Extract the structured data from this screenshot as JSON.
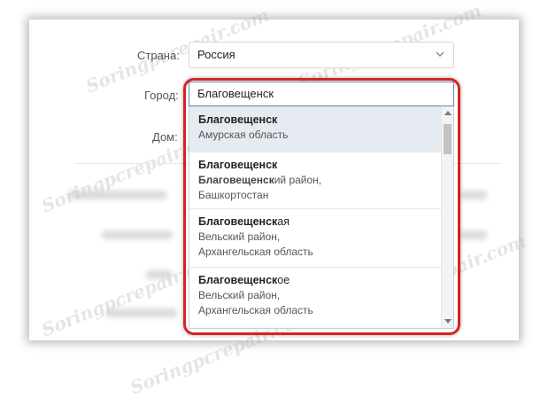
{
  "form": {
    "country_label": "Страна:",
    "country_value": "Россия",
    "city_label": "Город:",
    "city_value": "Благовещенск",
    "house_label": "Дом:"
  },
  "dropdown": {
    "options": [
      {
        "match": "Благовещенск",
        "rest": "",
        "sub1_match": "",
        "sub1_rest": "Амурская область",
        "sub2": ""
      },
      {
        "match": "Благовещенск",
        "rest": "",
        "sub1_match": "Благовещенск",
        "sub1_rest": "ий район,",
        "sub2": "Башкортостан"
      },
      {
        "match": "Благовещенск",
        "rest": "ая",
        "sub1_match": "",
        "sub1_rest": "Вельский район,",
        "sub2": "Архангельская область"
      },
      {
        "match": "Благовещенск",
        "rest": "ое",
        "sub1_match": "",
        "sub1_rest": "Вельский район,",
        "sub2": "Архангельская область"
      }
    ]
  },
  "watermark": "Soringpcrepair.com",
  "icons": {
    "country_chevron": "chevron-down-icon",
    "scroll_up": "arrow-up-icon",
    "scroll_down": "arrow-down-icon"
  },
  "colors": {
    "highlight_frame": "#d92121",
    "active_option": "#e5ebf1",
    "input_border": "#5b88bd"
  }
}
